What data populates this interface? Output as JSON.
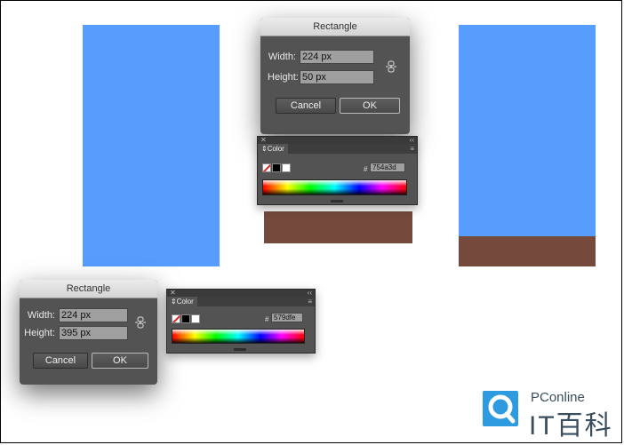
{
  "top_dialog": {
    "title": "Rectangle",
    "width_label": "Width:",
    "width_value": "224 px",
    "height_label": "Height:",
    "height_value": "50 px",
    "cancel_label": "Cancel",
    "ok_label": "OK"
  },
  "top_color_panel": {
    "tab_label": "Color",
    "hash": "#",
    "hex_value": "754a3d"
  },
  "bottom_dialog": {
    "title": "Rectangle",
    "width_label": "Width:",
    "width_value": "224 px",
    "height_label": "Height:",
    "height_value": "395 px",
    "cancel_label": "Cancel",
    "ok_label": "OK"
  },
  "bottom_color_panel": {
    "tab_label": "Color",
    "hash": "#",
    "hex_value": "579dfe"
  },
  "colors": {
    "blue_rect": "#579dfe",
    "brown_rect": "#754a3d",
    "dialog_bg": "#535353"
  },
  "logo": {
    "brand_top": "PConline",
    "brand_main": "IT百科"
  }
}
